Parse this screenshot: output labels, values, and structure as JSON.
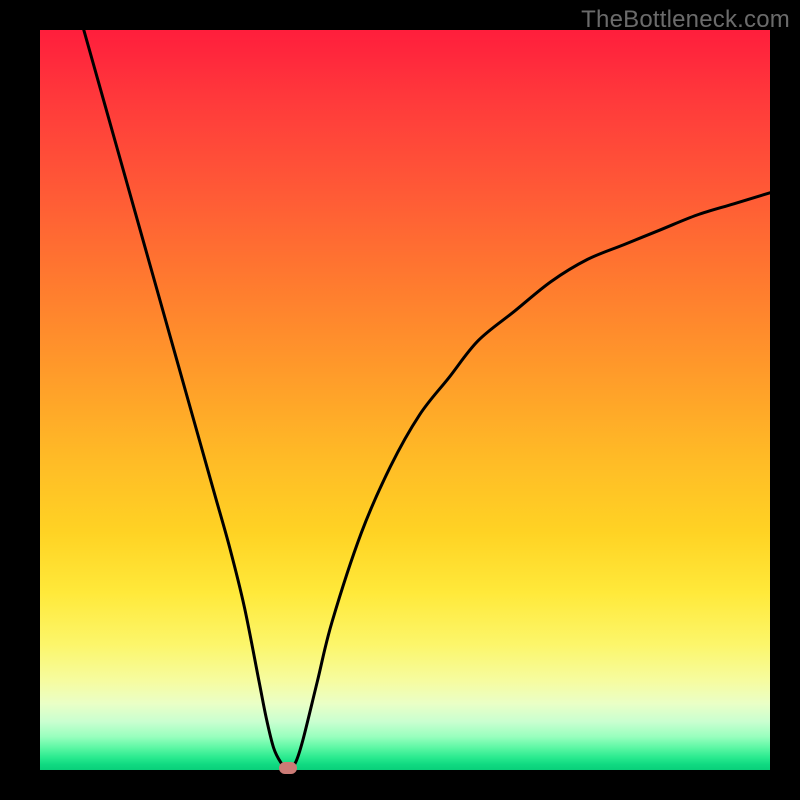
{
  "watermark": "TheBottleneck.com",
  "colors": {
    "frame": "#000000",
    "gradient_top": "#ff1e3c",
    "gradient_bottom": "#09cf7a",
    "curve": "#000000",
    "marker": "#cb7b76",
    "watermark_text": "#6b6b6b"
  },
  "chart_data": {
    "type": "line",
    "title": "",
    "xlabel": "",
    "ylabel": "",
    "xlim": [
      0,
      100
    ],
    "ylim": [
      0,
      100
    ],
    "legend": false,
    "grid": false,
    "series": [
      {
        "name": "bottleneck-curve",
        "x": [
          6,
          8,
          10,
          12,
          14,
          16,
          18,
          20,
          22,
          24,
          26,
          28,
          30,
          31,
          32,
          33,
          34,
          35,
          36,
          38,
          40,
          44,
          48,
          52,
          56,
          60,
          65,
          70,
          75,
          80,
          85,
          90,
          95,
          100
        ],
        "y": [
          100,
          93,
          86,
          79,
          72,
          65,
          58,
          51,
          44,
          37,
          30,
          22,
          12,
          7,
          3,
          1,
          0,
          1,
          4,
          12,
          20,
          32,
          41,
          48,
          53,
          58,
          62,
          66,
          69,
          71,
          73,
          75,
          76.5,
          78
        ]
      }
    ],
    "marker": {
      "x": 34,
      "y": 0
    },
    "annotations": []
  }
}
